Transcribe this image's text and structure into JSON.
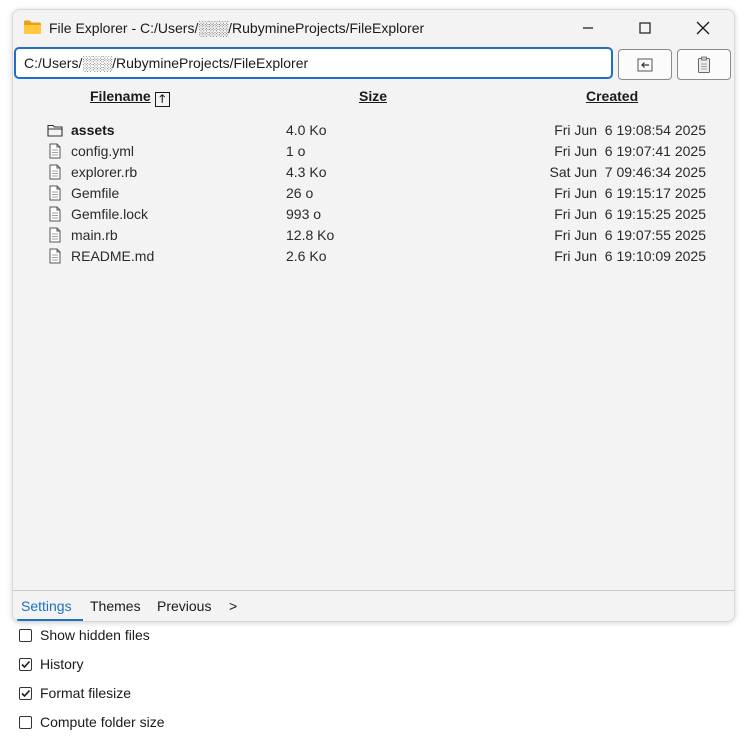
{
  "window": {
    "title": "File Explorer - C:/Users/░░░/RubymineProjects/FileExplorer"
  },
  "path": {
    "value": "C:/Users/░░░/RubymineProjects/FileExplorer"
  },
  "columns": {
    "filename": "Filename",
    "size": "Size",
    "created": "Created"
  },
  "files": [
    {
      "name": "assets",
      "size": "4.0 Ko",
      "created": "Fri Jun  6 19:08:54 2025",
      "type": "folder"
    },
    {
      "name": "config.yml",
      "size": "1 o",
      "created": "Fri Jun  6 19:07:41 2025",
      "type": "file"
    },
    {
      "name": "explorer.rb",
      "size": "4.3 Ko",
      "created": "Sat Jun  7 09:46:34 2025",
      "type": "file"
    },
    {
      "name": "Gemfile",
      "size": "26 o",
      "created": "Fri Jun  6 19:15:17 2025",
      "type": "file"
    },
    {
      "name": "Gemfile.lock",
      "size": "993 o",
      "created": "Fri Jun  6 19:15:25 2025",
      "type": "file"
    },
    {
      "name": "main.rb",
      "size": "12.8 Ko",
      "created": "Fri Jun  6 19:07:55 2025",
      "type": "file"
    },
    {
      "name": "README.md",
      "size": "2.6 Ko",
      "created": "Fri Jun  6 19:10:09 2025",
      "type": "file"
    }
  ],
  "tabs": [
    {
      "label": "Settings",
      "active": true
    },
    {
      "label": "Themes",
      "active": false
    },
    {
      "label": "Previous",
      "active": false
    },
    {
      "label": ">",
      "active": false
    }
  ],
  "settings": [
    {
      "label": "Show hidden files",
      "checked": false
    },
    {
      "label": "History",
      "checked": true
    },
    {
      "label": "Format filesize",
      "checked": true
    },
    {
      "label": "Compute folder size",
      "checked": false
    }
  ],
  "colors": {
    "accent": "#1f6fc6",
    "window_bg": "#f3f3f3"
  }
}
